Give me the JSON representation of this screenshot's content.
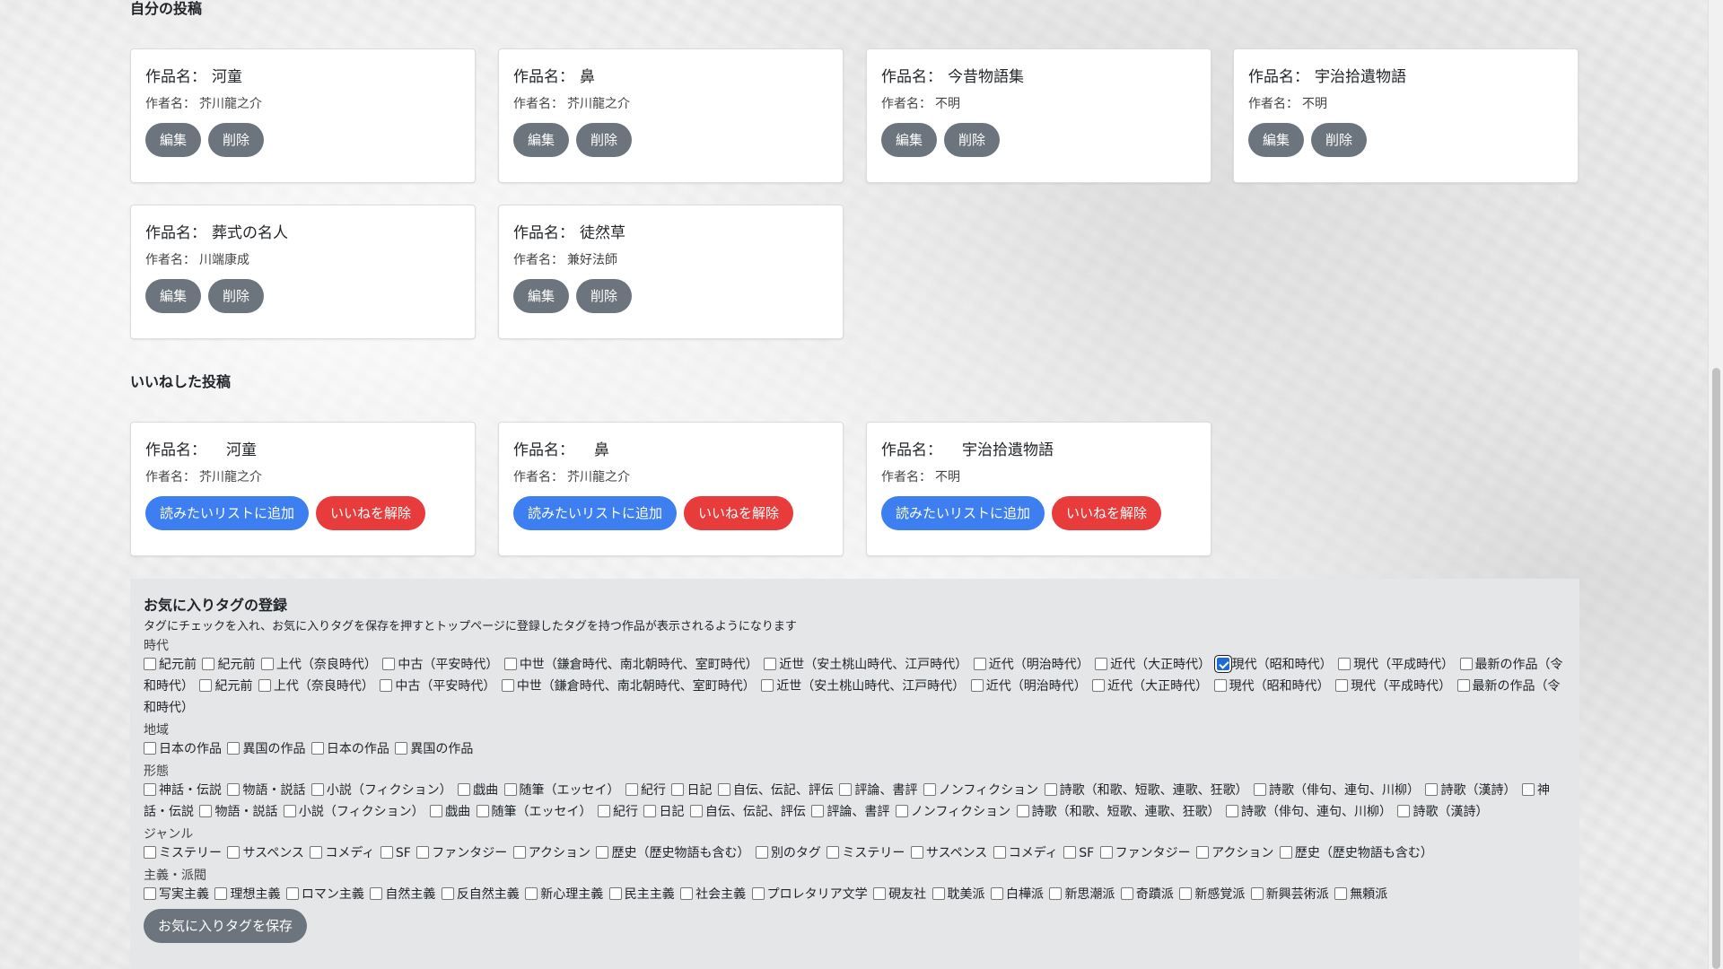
{
  "my_posts": {
    "heading": "自分の投稿",
    "title_label": "作品名：",
    "author_label": "作者名：",
    "edit_label": "編集",
    "delete_label": "削除",
    "items": [
      {
        "title": "河童",
        "author": "芥川龍之介"
      },
      {
        "title": "鼻",
        "author": "芥川龍之介"
      },
      {
        "title": "今昔物語集",
        "author": "不明"
      },
      {
        "title": "宇治拾遺物語",
        "author": "不明"
      },
      {
        "title": "葬式の名人",
        "author": "川端康成"
      },
      {
        "title": "徒然草",
        "author": "兼好法師"
      }
    ]
  },
  "liked_posts": {
    "heading": "いいねした投稿",
    "title_label": "作品名：",
    "author_label": "作者名：",
    "add_list_label": "読みたいリストに追加",
    "unlike_label": "いいねを解除",
    "items": [
      {
        "title": "河童",
        "author": "芥川龍之介"
      },
      {
        "title": "鼻",
        "author": "芥川龍之介"
      },
      {
        "title": "宇治拾遺物語",
        "author": "不明"
      }
    ]
  },
  "favorite_tags": {
    "heading": "お気に入りタグの登録",
    "description": "タグにチェックを入れ、お気に入りタグを保存を押すとトップページに登録したタグを持つ作品が表示されるようになります",
    "save_label": "お気に入りタグを保存",
    "categories": [
      {
        "label": "時代",
        "tags": [
          {
            "name": "紀元前",
            "checked": false
          },
          {
            "name": "紀元前",
            "checked": false
          },
          {
            "name": "上代（奈良時代）",
            "checked": false
          },
          {
            "name": "中古（平安時代）",
            "checked": false
          },
          {
            "name": "中世（鎌倉時代、南北朝時代、室町時代）",
            "checked": false
          },
          {
            "name": "近世（安土桃山時代、江戸時代）",
            "checked": false
          },
          {
            "name": "近代（明治時代）",
            "checked": false
          },
          {
            "name": "近代（大正時代）",
            "checked": false
          },
          {
            "name": "現代（昭和時代）",
            "checked": true
          },
          {
            "name": "現代（平成時代）",
            "checked": false
          },
          {
            "name": "最新の作品（令和時代）",
            "checked": false
          },
          {
            "name": "紀元前",
            "checked": false
          },
          {
            "name": "上代（奈良時代）",
            "checked": false
          },
          {
            "name": "中古（平安時代）",
            "checked": false
          },
          {
            "name": "中世（鎌倉時代、南北朝時代、室町時代）",
            "checked": false
          },
          {
            "name": "近世（安土桃山時代、江戸時代）",
            "checked": false
          },
          {
            "name": "近代（明治時代）",
            "checked": false
          },
          {
            "name": "近代（大正時代）",
            "checked": false
          },
          {
            "name": "現代（昭和時代）",
            "checked": false
          },
          {
            "name": "現代（平成時代）",
            "checked": false
          },
          {
            "name": "最新の作品（令和時代）",
            "checked": false
          }
        ]
      },
      {
        "label": "地域",
        "tags": [
          {
            "name": "日本の作品",
            "checked": false
          },
          {
            "name": "異国の作品",
            "checked": false
          },
          {
            "name": "日本の作品",
            "checked": false
          },
          {
            "name": "異国の作品",
            "checked": false
          }
        ]
      },
      {
        "label": "形態",
        "tags": [
          {
            "name": "神話・伝説",
            "checked": false
          },
          {
            "name": "物語・説話",
            "checked": false
          },
          {
            "name": "小説（フィクション）",
            "checked": false
          },
          {
            "name": "戯曲",
            "checked": false
          },
          {
            "name": "随筆（エッセイ）",
            "checked": false
          },
          {
            "name": "紀行",
            "checked": false
          },
          {
            "name": "日記",
            "checked": false
          },
          {
            "name": "自伝、伝記、評伝",
            "checked": false
          },
          {
            "name": "評論、書評",
            "checked": false
          },
          {
            "name": "ノンフィクション",
            "checked": false
          },
          {
            "name": "詩歌（和歌、短歌、連歌、狂歌）",
            "checked": false
          },
          {
            "name": "詩歌（俳句、連句、川柳）",
            "checked": false
          },
          {
            "name": "詩歌（漢詩）",
            "checked": false
          },
          {
            "name": "神話・伝説",
            "checked": false
          },
          {
            "name": "物語・説話",
            "checked": false
          },
          {
            "name": "小説（フィクション）",
            "checked": false
          },
          {
            "name": "戯曲",
            "checked": false
          },
          {
            "name": "随筆（エッセイ）",
            "checked": false
          },
          {
            "name": "紀行",
            "checked": false
          },
          {
            "name": "日記",
            "checked": false
          },
          {
            "name": "自伝、伝記、評伝",
            "checked": false
          },
          {
            "name": "評論、書評",
            "checked": false
          },
          {
            "name": "ノンフィクション",
            "checked": false
          },
          {
            "name": "詩歌（和歌、短歌、連歌、狂歌）",
            "checked": false
          },
          {
            "name": "詩歌（俳句、連句、川柳）",
            "checked": false
          },
          {
            "name": "詩歌（漢詩）",
            "checked": false
          }
        ]
      },
      {
        "label": "ジャンル",
        "tags": [
          {
            "name": "ミステリー",
            "checked": false
          },
          {
            "name": "サスペンス",
            "checked": false
          },
          {
            "name": "コメディ",
            "checked": false
          },
          {
            "name": "SF",
            "checked": false
          },
          {
            "name": "ファンタジー",
            "checked": false
          },
          {
            "name": "アクション",
            "checked": false
          },
          {
            "name": "歴史（歴史物語も含む）",
            "checked": false
          },
          {
            "name": "別のタグ",
            "checked": false
          },
          {
            "name": "ミステリー",
            "checked": false
          },
          {
            "name": "サスペンス",
            "checked": false
          },
          {
            "name": "コメディ",
            "checked": false
          },
          {
            "name": "SF",
            "checked": false
          },
          {
            "name": "ファンタジー",
            "checked": false
          },
          {
            "name": "アクション",
            "checked": false
          },
          {
            "name": "歴史（歴史物語も含む）",
            "checked": false
          }
        ]
      },
      {
        "label": "主義・派閥",
        "tags": [
          {
            "name": "写実主義",
            "checked": false
          },
          {
            "name": "理想主義",
            "checked": false
          },
          {
            "name": "ロマン主義",
            "checked": false
          },
          {
            "name": "自然主義",
            "checked": false
          },
          {
            "name": "反自然主義",
            "checked": false
          },
          {
            "name": "新心理主義",
            "checked": false
          },
          {
            "name": "民主主義",
            "checked": false
          },
          {
            "name": "社会主義",
            "checked": false
          },
          {
            "name": "プロレタリア文学",
            "checked": false
          },
          {
            "name": "硯友社",
            "checked": false
          },
          {
            "name": "耽美派",
            "checked": false
          },
          {
            "name": "白樺派",
            "checked": false
          },
          {
            "name": "新思潮派",
            "checked": false
          },
          {
            "name": "奇蹟派",
            "checked": false
          },
          {
            "name": "新感覚派",
            "checked": false
          },
          {
            "name": "新興芸術派",
            "checked": false
          },
          {
            "name": "無頼派",
            "checked": false
          }
        ]
      }
    ]
  }
}
